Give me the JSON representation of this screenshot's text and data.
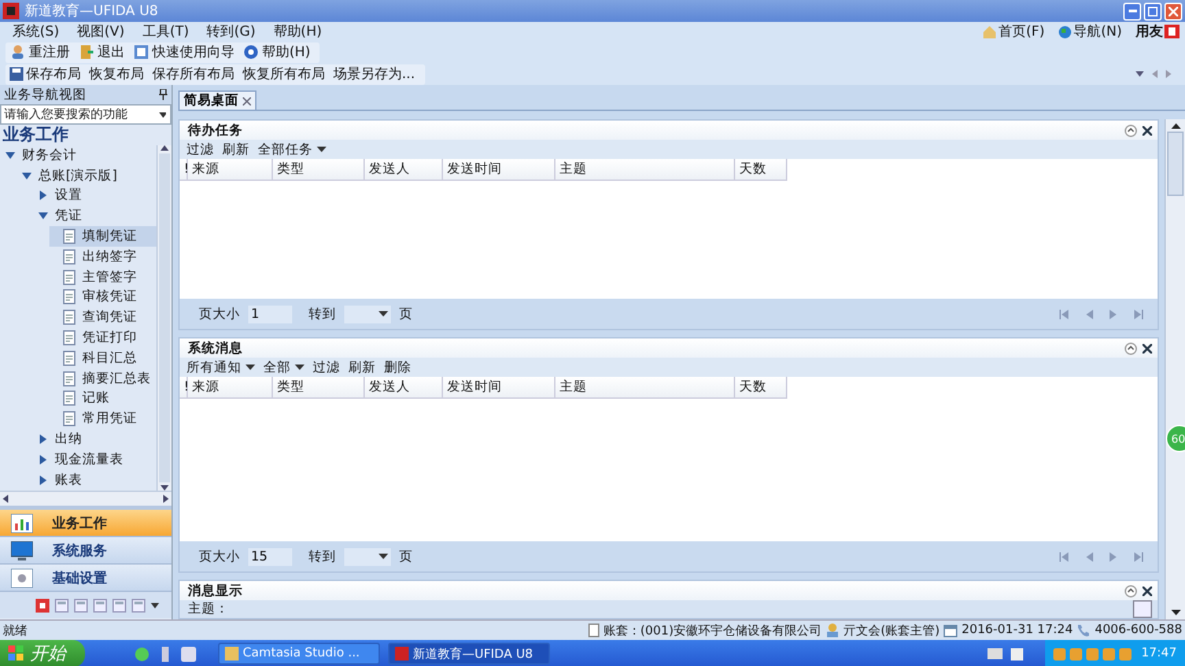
{
  "window": {
    "title": "新道教育—UFIDA U8"
  },
  "menu": [
    "系统(S)",
    "视图(V)",
    "工具(T)",
    "转到(G)",
    "帮助(H)"
  ],
  "toolbar": [
    "重注册",
    "退出",
    "快速使用向导",
    "帮助(H)"
  ],
  "header_links": [
    "首页(F)",
    "导航(N)"
  ],
  "logo": {
    "text": "用友"
  },
  "layout_bar": [
    "保存布局",
    "恢复布局",
    "保存所有布局",
    "恢复所有布局",
    "场景另存为..."
  ],
  "nav": {
    "title": "业务导航视图",
    "search": {
      "placeholder": "请输入您要搜索的功能"
    },
    "heading": "业务工作",
    "tree": [
      {
        "label": "财务会计",
        "kind": "folder",
        "expanded": true,
        "selected": false,
        "children": [
          {
            "label": "总账[演示版]",
            "kind": "folder",
            "expanded": true,
            "selected": false,
            "children": [
              {
                "label": "设置",
                "kind": "folder",
                "expanded": false,
                "selected": false
              },
              {
                "label": "凭证",
                "kind": "folder",
                "expanded": true,
                "selected": false,
                "children": [
                  {
                    "label": "填制凭证",
                    "kind": "leaf",
                    "selected": true
                  },
                  {
                    "label": "出纳签字",
                    "kind": "leaf",
                    "selected": false
                  },
                  {
                    "label": "主管签字",
                    "kind": "leaf",
                    "selected": false
                  },
                  {
                    "label": "审核凭证",
                    "kind": "leaf",
                    "selected": false
                  },
                  {
                    "label": "查询凭证",
                    "kind": "leaf",
                    "selected": false
                  },
                  {
                    "label": "凭证打印",
                    "kind": "leaf",
                    "selected": false
                  },
                  {
                    "label": "科目汇总",
                    "kind": "leaf",
                    "selected": false
                  },
                  {
                    "label": "摘要汇总表",
                    "kind": "leaf",
                    "selected": false
                  },
                  {
                    "label": "记账",
                    "kind": "leaf",
                    "selected": false
                  },
                  {
                    "label": "常用凭证",
                    "kind": "leaf",
                    "selected": false
                  }
                ]
              },
              {
                "label": "出纳",
                "kind": "folder",
                "expanded": false,
                "selected": false
              },
              {
                "label": "现金流量表",
                "kind": "folder",
                "expanded": false,
                "selected": false
              },
              {
                "label": "账表",
                "kind": "folder",
                "expanded": false,
                "selected": false
              }
            ]
          }
        ]
      }
    ],
    "modules": [
      {
        "label": "业务工作",
        "selected": true
      },
      {
        "label": "系统服务",
        "selected": false
      },
      {
        "label": "基础设置",
        "selected": false
      }
    ]
  },
  "tabs": [
    {
      "label": "简易桌面",
      "selected": true
    }
  ],
  "panels": [
    {
      "kind": "grid",
      "title": "待办任务",
      "actions": [
        {
          "label": "过滤",
          "dropdown": false
        },
        {
          "label": "刷新",
          "dropdown": false
        },
        {
          "label": "全部任务",
          "dropdown": true
        }
      ],
      "columns": [
        "!",
        "来源",
        "类型",
        "发送人",
        "发送时间",
        "主题",
        "天数"
      ],
      "page_size_label": "页大小",
      "page_size": "1",
      "goto_label": "转到",
      "page_label": "页"
    },
    {
      "kind": "grid",
      "title": "系统消息",
      "actions": [
        {
          "label": "所有通知",
          "dropdown": true
        },
        {
          "label": "全部",
          "dropdown": true
        },
        {
          "label": "过滤",
          "dropdown": false
        },
        {
          "label": "刷新",
          "dropdown": false
        },
        {
          "label": "删除",
          "dropdown": false
        }
      ],
      "columns": [
        "!",
        "来源",
        "类型",
        "发送人",
        "发送时间",
        "主题",
        "天数"
      ],
      "page_size_label": "页大小",
      "page_size": "15",
      "goto_label": "转到",
      "page_label": "页"
    },
    {
      "kind": "message",
      "title": "消息显示",
      "subject_label": "主题："
    }
  ],
  "badge": "60",
  "status_bar": {
    "text": "就绪",
    "account": "账套：(001)安徽环宇仓储设备有限公司",
    "user": "亓文会(账套主管)",
    "datetime": "2016-01-31 17:24",
    "phone": "4006-600-588"
  },
  "taskbar": {
    "start": "开始",
    "tasks": [
      {
        "label": "Camtasia Studio ...",
        "selected": false
      },
      {
        "label": "新道教育—UFIDA U8",
        "selected": true
      }
    ],
    "clock": "17:47"
  }
}
